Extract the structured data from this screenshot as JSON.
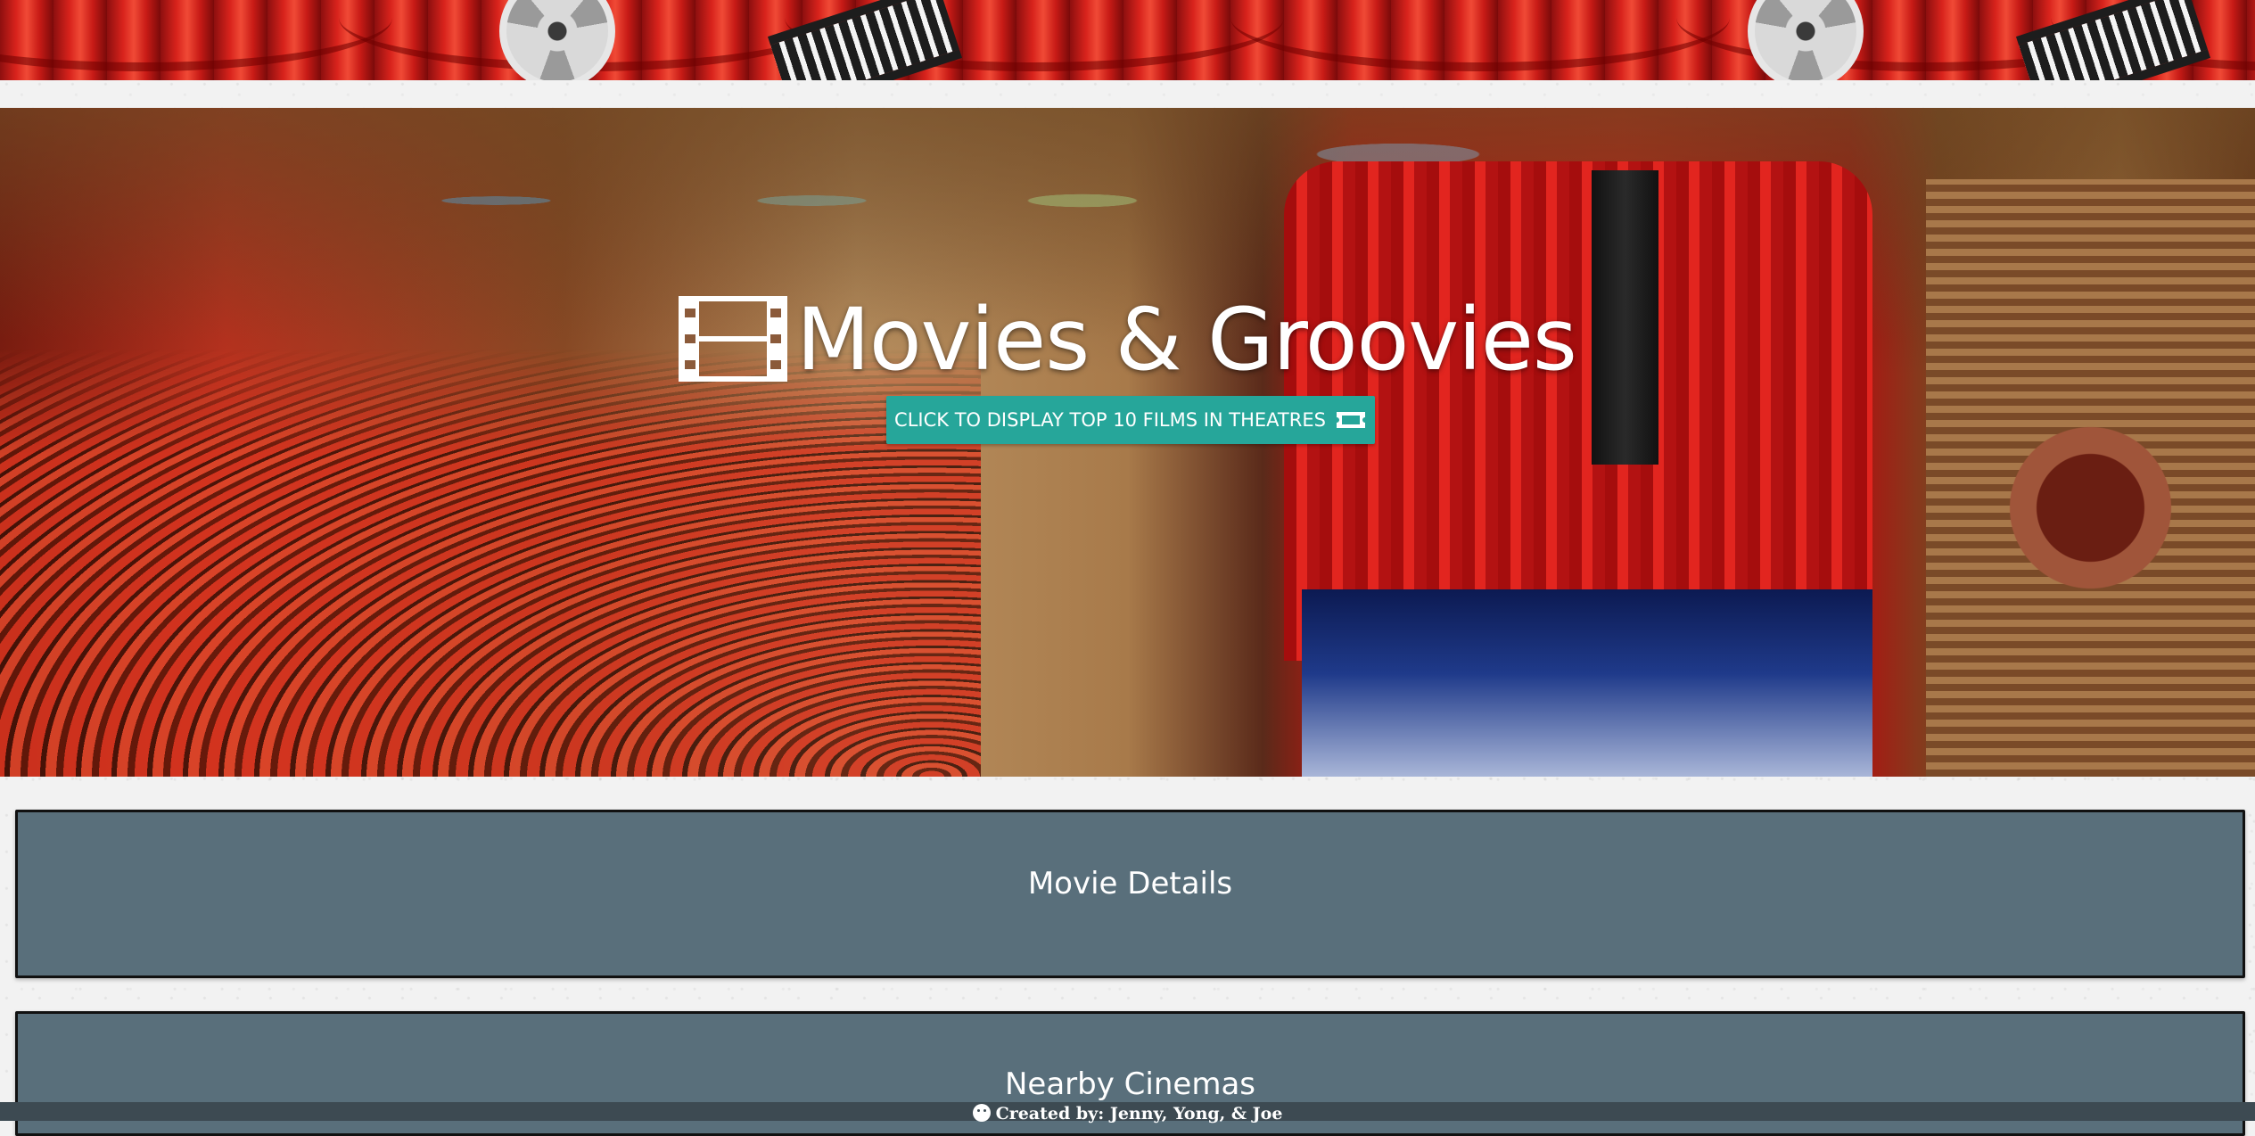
{
  "site": {
    "title": "Movies & Groovies",
    "icon": "film-icon"
  },
  "hero": {
    "button_label": "CLICK TO DISPLAY TOP 10 FILMS IN THEATRES",
    "button_icon": "ticket-icon",
    "button_color": "#26a69a"
  },
  "sections": {
    "movie_details": "Movie Details",
    "nearby_cinemas": "Nearby Cinemas"
  },
  "footer": {
    "credit": "Created by: Jenny, Yong, & Joe",
    "icon": "smile-icon"
  },
  "colors": {
    "panel": "#596f7b",
    "background": "#f2f2f2"
  }
}
